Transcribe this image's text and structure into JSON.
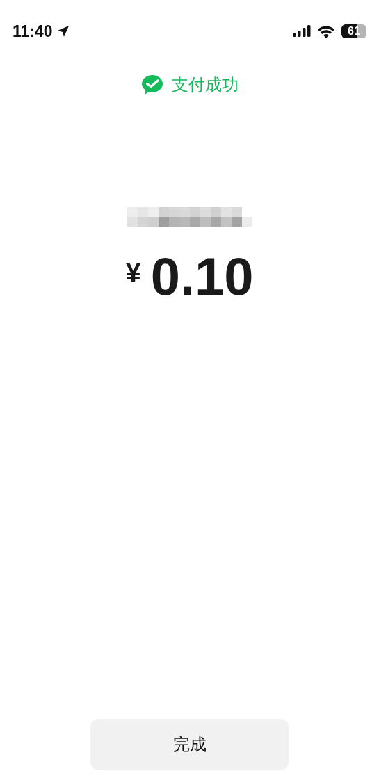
{
  "status_bar": {
    "time": "11:40",
    "battery": "61"
  },
  "header": {
    "title": "支付成功"
  },
  "payment": {
    "currency": "¥",
    "amount": "0.10"
  },
  "buttons": [
    {
      "label": "完成"
    }
  ]
}
